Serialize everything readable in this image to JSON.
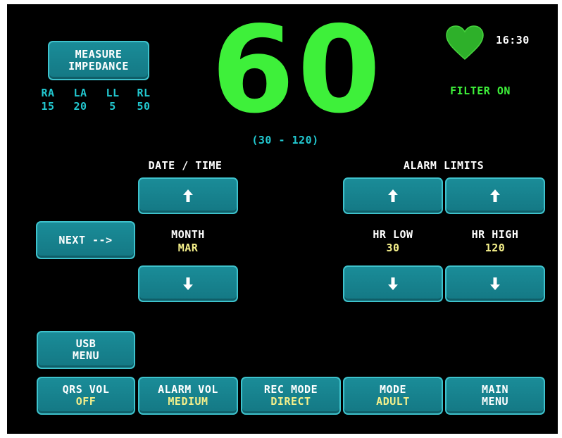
{
  "impedance": {
    "button_label": [
      "MEASURE",
      "IMPEDANCE"
    ],
    "leads": [
      {
        "name": "RA",
        "value": "15"
      },
      {
        "name": "LA",
        "value": "20"
      },
      {
        "name": "LL",
        "value": "5"
      },
      {
        "name": "RL",
        "value": "50"
      }
    ]
  },
  "heart_rate": {
    "value": "60",
    "range": "(30 - 120)"
  },
  "status": {
    "time": "16:30",
    "filter": "FILTER ON"
  },
  "date_time": {
    "title": "DATE / TIME",
    "field_label": "MONTH",
    "field_value": "MAR"
  },
  "next_button": "NEXT -->",
  "alarm_limits": {
    "title": "ALARM LIMITS",
    "low_label": "HR LOW",
    "low_value": "30",
    "high_label": "HR HIGH",
    "high_value": "120"
  },
  "usb_menu": [
    "USB",
    "MENU"
  ],
  "bottom_buttons": [
    {
      "label": "QRS VOL",
      "value": "OFF"
    },
    {
      "label": "ALARM VOL",
      "value": "MEDIUM"
    },
    {
      "label": "REC MODE",
      "value": "DIRECT"
    },
    {
      "label": "MODE",
      "value": "ADULT"
    },
    {
      "label": "MAIN",
      "value": "MENU"
    }
  ],
  "colors": {
    "trace_green": "#3ef03a",
    "label_cyan": "#22c8d0",
    "value_yellow": "#f5f08a",
    "button_teal": "#168492"
  }
}
